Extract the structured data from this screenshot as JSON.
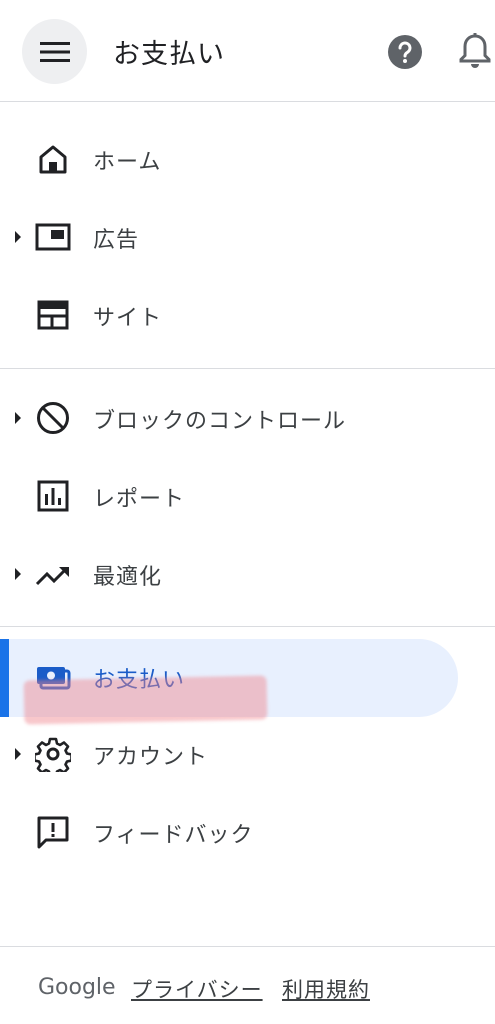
{
  "header": {
    "title": "お支払い",
    "menu_icon": "hamburger-menu-icon",
    "help_icon": "help-icon",
    "notifications_icon": "bell-icon"
  },
  "nav": {
    "items": [
      {
        "label": "ホーム",
        "icon": "home-icon",
        "expandable": false
      },
      {
        "label": "広告",
        "icon": "ads-icon",
        "expandable": true
      },
      {
        "label": "サイト",
        "icon": "sites-icon",
        "expandable": false
      },
      {
        "label": "ブロックのコントロール",
        "icon": "block-icon",
        "expandable": true
      },
      {
        "label": "レポート",
        "icon": "reports-icon",
        "expandable": false
      },
      {
        "label": "最適化",
        "icon": "trending-up-icon",
        "expandable": true
      },
      {
        "label": "お支払い",
        "icon": "payments-icon",
        "expandable": false,
        "active": true
      },
      {
        "label": "アカウント",
        "icon": "gear-icon",
        "expandable": true
      },
      {
        "label": "フィードバック",
        "icon": "feedback-icon",
        "expandable": false
      }
    ]
  },
  "footer": {
    "brand": "Google",
    "links": [
      "プライバシー",
      "利用規約"
    ]
  },
  "colors": {
    "active_bg": "#e8f0fe",
    "active_bar": "#1a73e8",
    "icon": "#202124",
    "divider": "#dadce0"
  }
}
